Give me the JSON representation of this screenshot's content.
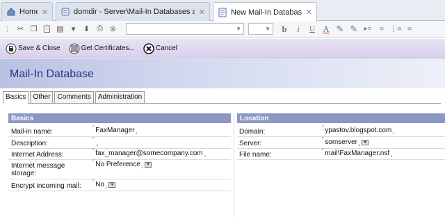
{
  "tabs": [
    {
      "label": "Home",
      "close": "✕",
      "icon": "home-icon"
    },
    {
      "label": "domdir - Server\\Mail-In Databases an...",
      "close": "✕",
      "icon": "database-icon"
    },
    {
      "label": "New Mail-In Database",
      "close": "✕",
      "icon": "document-icon"
    }
  ],
  "toolbar": {
    "icons": [
      "cut-icon",
      "copy-icon",
      "paste-icon",
      "paste-special-icon",
      "new-icon",
      "download-icon",
      "print-icon",
      "stop-icon"
    ],
    "format": [
      "b",
      "i",
      "U",
      "A",
      "✎",
      "✎",
      "▸≡",
      "≡",
      "⋮≡",
      "≡"
    ]
  },
  "actions": [
    {
      "label": "Save & Close",
      "icon": "save-icon"
    },
    {
      "label": "Get Certificates...",
      "icon": "certificate-icon"
    },
    {
      "label": "Cancel",
      "icon": "cancel-icon"
    }
  ],
  "form_title": "Mail-In Database",
  "form_tabs": [
    "Basics",
    "Other",
    "Comments",
    "Administration"
  ],
  "basics": {
    "header": "Basics",
    "fields": [
      {
        "label": "Mail-in name:",
        "value": "FaxManager"
      },
      {
        "label": "Description:",
        "value": ""
      },
      {
        "label": "Internet Address:",
        "value": "fax_manager@somecompany.com"
      },
      {
        "label": "Internet message storage:",
        "value": "No Preference"
      },
      {
        "label": "Encrypt incoming mail:",
        "value": "No"
      }
    ]
  },
  "location": {
    "header": "Location",
    "fields": [
      {
        "label": "Domain:",
        "value": "ypastov.blogspot.com"
      },
      {
        "label": "Server:",
        "value": "somserver"
      },
      {
        "label": "File name:",
        "value": "mail\\FaxManager.nsf"
      }
    ]
  },
  "colors": {
    "banner_text": "#223a86",
    "section_header": "#8c97c4",
    "actionbar": "#d9d0ec"
  }
}
